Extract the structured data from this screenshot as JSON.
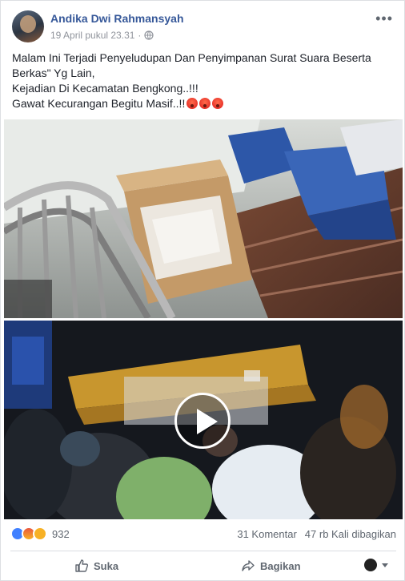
{
  "post": {
    "author": "Andika Dwi Rahmansyah",
    "timestamp": "19 April pukul 23.31",
    "separator": "·",
    "more_label": "•••",
    "text_lines": [
      "Malam Ini Terjadi Penyeludupan Dan Penyimpanan Surat Suara Beserta Berkas\" Yg Lain,",
      "Kejadian Di Kecamatan Bengkong..!!!",
      "Gawat Kecurangan Begitu Masif..!!"
    ]
  },
  "media": {
    "photo_icon": "photo-boxes-stairway",
    "video_icon": "play-icon"
  },
  "stats": {
    "reaction_icons": [
      "like-icon",
      "angry-icon",
      "wow-icon"
    ],
    "reaction_count": "932",
    "comments": "31 Komentar",
    "shares": "47 rb Kali dibagikan"
  },
  "actions": {
    "like_label": "Suka",
    "share_label": "Bagikan"
  },
  "colors": {
    "link": "#365899",
    "muted": "#90949c",
    "like_blue": "#4080ff"
  }
}
